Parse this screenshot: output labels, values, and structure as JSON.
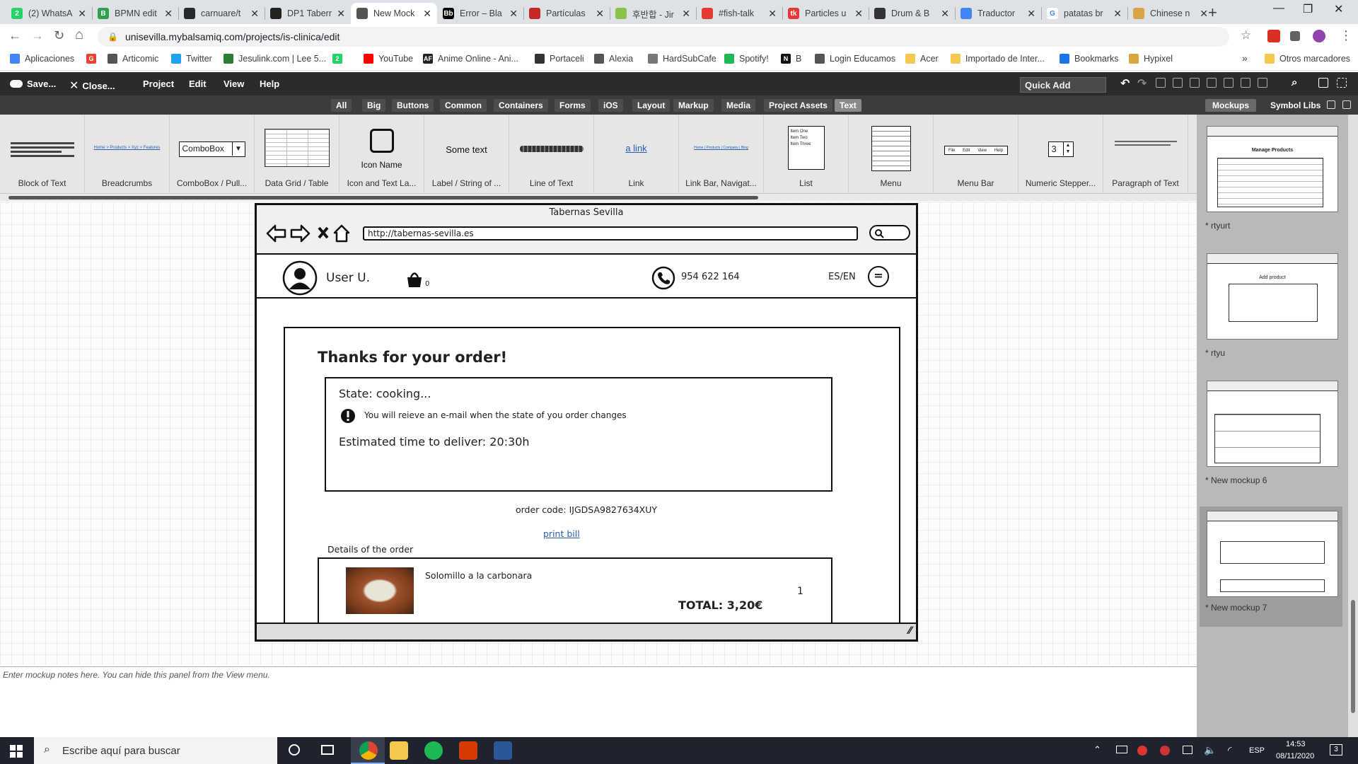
{
  "browser": {
    "tabs": [
      {
        "title": "(2) WhatsA",
        "color": "#25d366",
        "glyph": "2",
        "close": "✕"
      },
      {
        "title": "BPMN edit",
        "color": "#2ca24d",
        "glyph": "B",
        "close": "✕"
      },
      {
        "title": "carnuare/t",
        "color": "#24292e",
        "glyph": "",
        "close": "✕"
      },
      {
        "title": "DP1 Taberr",
        "color": "#222222",
        "glyph": "",
        "close": "✕"
      },
      {
        "title": "New Mock",
        "color": "#555555",
        "glyph": "",
        "close": "✕"
      },
      {
        "title": "Error – Bla",
        "color": "#000000",
        "glyph": "Bb",
        "close": "✕"
      },
      {
        "title": "Partículas",
        "color": "#c62828",
        "glyph": "",
        "close": "✕"
      },
      {
        "title": "후반합 - Jir",
        "color": "#8bc34a",
        "glyph": "",
        "close": "✕"
      },
      {
        "title": "#fish-talk",
        "color": "#e53935",
        "glyph": "",
        "close": "✕"
      },
      {
        "title": "Particles u",
        "color": "#e53935",
        "glyph": "tk",
        "close": "✕"
      },
      {
        "title": "Drum & B",
        "color": "#333333",
        "glyph": "",
        "close": "✕"
      },
      {
        "title": "Traductor",
        "color": "#4285f4",
        "glyph": "",
        "close": "✕"
      },
      {
        "title": "patatas br",
        "color": "#ffffff",
        "glyph": "G",
        "close": "✕"
      },
      {
        "title": "Chinese n",
        "color": "#d9a441",
        "glyph": "",
        "close": "✕"
      }
    ],
    "new_tab": "+",
    "window": {
      "minimize": "—",
      "maximize": "❐",
      "close": "✕"
    },
    "url": "unisevilla.mybalsamiq.com/projects/is-clinica/edit",
    "nav": {
      "back": "←",
      "forward": "→",
      "reload": "↻",
      "home": "⌂",
      "lock": "🔒",
      "star": "☆",
      "menu": "⋮"
    },
    "bookmarks": [
      {
        "label": "Aplicaciones",
        "color": "#4285f4"
      },
      {
        "label": "",
        "color": "#ea4335",
        "glyph": "G"
      },
      {
        "label": "Articomic",
        "color": "#555555"
      },
      {
        "label": "Twitter",
        "color": "#1da1f2"
      },
      {
        "label": "Jesulink.com | Lee 5...",
        "color": "#2e7d32"
      },
      {
        "label": "",
        "color": "#25d366",
        "glyph": "2"
      },
      {
        "label": "YouTube",
        "color": "#ff0000"
      },
      {
        "label": "Anime Online - Ani...",
        "color": "#222222",
        "glyph": "AF"
      },
      {
        "label": "Portaceli",
        "color": "#333333"
      },
      {
        "label": "Alexia",
        "color": "#555555"
      },
      {
        "label": "HardSubCafe",
        "color": "#777777"
      },
      {
        "label": "Spotify!",
        "color": "#1db954"
      },
      {
        "label": "B",
        "color": "#111111",
        "glyph": "N"
      },
      {
        "label": "Login Educamos",
        "color": "#555555"
      },
      {
        "label": "Acer",
        "color": "#f2c94c"
      },
      {
        "label": "Importado de Inter...",
        "color": "#f2c94c"
      },
      {
        "label": "Bookmarks",
        "color": "#1a73e8"
      },
      {
        "label": "Hypixel",
        "color": "#d9a441"
      }
    ],
    "bookmarks_more": "»",
    "other_bookmarks": "Otros marcadores"
  },
  "balsamiq": {
    "menubar": {
      "save": "Save...",
      "close": "Close...",
      "menus": [
        "Project",
        "Edit",
        "View",
        "Help"
      ],
      "quick_add_placeholder": "Quick Add"
    },
    "categories": [
      "All",
      "Big",
      "Buttons",
      "Common",
      "Containers",
      "Forms",
      "iOS",
      "Layout",
      "Markup",
      "Media",
      "Project Assets",
      "Text"
    ],
    "selected_category": "Text",
    "panel_tabs": [
      "Mockups",
      "Symbol Libs"
    ],
    "library_items": [
      {
        "label": "Block of Text"
      },
      {
        "label": "Breadcrumbs",
        "preview": "Home > Products > Xyz > Features"
      },
      {
        "label": "ComboBox / Pull...",
        "preview": "ComboBox"
      },
      {
        "label": "Data Grid / Table"
      },
      {
        "label": "Icon and Text La...",
        "preview": "Icon Name"
      },
      {
        "label": "Label / String of ...",
        "preview": "Some text"
      },
      {
        "label": "Line of Text"
      },
      {
        "label": "Link",
        "preview": "a link"
      },
      {
        "label": "Link Bar, Navigat...",
        "preview": "Home | Products | Company | Blog"
      },
      {
        "label": "List",
        "preview_items": [
          "Item One",
          "Item Two",
          "Item Three"
        ]
      },
      {
        "label": "Menu"
      },
      {
        "label": "Menu Bar",
        "preview_items": [
          "File",
          "Edit",
          "View",
          "Help"
        ]
      },
      {
        "label": "Numeric Stepper...",
        "preview": "3"
      },
      {
        "label": "Paragraph of Text"
      }
    ],
    "mockups": [
      {
        "label": "* rtyurt",
        "selected": false,
        "heading": "Manage Products"
      },
      {
        "label": "* rtyu",
        "selected": false,
        "heading": "Add product"
      },
      {
        "label": "* New mockup 6",
        "selected": false
      },
      {
        "label": "* New mockup 7",
        "selected": true
      }
    ],
    "notes_placeholder": "Enter mockup notes here. You can hide this panel from the View menu."
  },
  "mockup": {
    "window_title": "Tabernas Sevilla",
    "url": "http://tabernas-sevilla.es",
    "user_name": "User U.",
    "cart_count": "0",
    "phone": "954 622 164",
    "language": "ES/EN",
    "menu_icon": "=",
    "thanks": "Thanks for your order!",
    "state": "State: cooking...",
    "email_notice": "You will reieve an e-mail when the state of you order changes",
    "estimated": "Estimated time to deliver: 20:30h",
    "order_code": "order code: IJGDSA9827634XUY",
    "print_bill": "print bill",
    "details_title": "Details of the order",
    "item_name": "Solomillo a la carbonara",
    "item_qty": "1",
    "total": "TOTAL: 3,20€"
  },
  "taskbar": {
    "search_placeholder": "Escribe aquí para buscar",
    "time": "14:53",
    "date": "08/11/2020",
    "lang": "ESP",
    "notifications": "3"
  }
}
